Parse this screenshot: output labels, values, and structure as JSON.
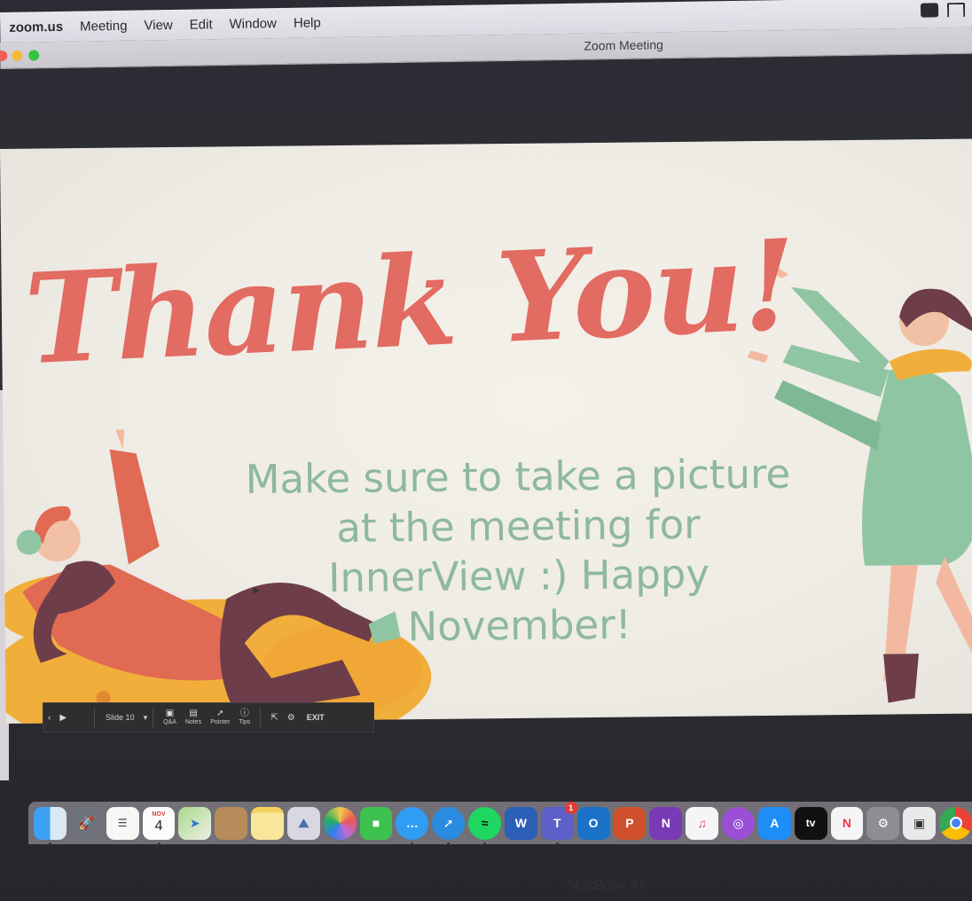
{
  "menubar": {
    "app": "zoom.us",
    "items": [
      "Meeting",
      "View",
      "Edit",
      "Window",
      "Help"
    ],
    "right_icons": [
      "zoom-status-icon",
      "airplay-icon"
    ]
  },
  "window": {
    "title": "Zoom Meeting"
  },
  "slide": {
    "title": "Thank You!",
    "subtitle": "Make sure to take a picture at the meeting for InnerView :) Happy November!",
    "colors": {
      "title": "#e26b62",
      "subtitle": "#8eb8a1",
      "background": "#f1eee7"
    }
  },
  "presenter_toolbar": {
    "slide_label": "Slide 10",
    "buttons": [
      {
        "label": "Q&A",
        "icon": "qa-icon"
      },
      {
        "label": "Notes",
        "icon": "notes-icon"
      },
      {
        "label": "Pointer",
        "icon": "pointer-icon"
      },
      {
        "label": "Tips",
        "icon": "tips-icon"
      }
    ],
    "exit_label": "EXIT"
  },
  "dock": {
    "calendar_month": "NOV",
    "calendar_day": "4",
    "teams_badge": "1",
    "tv_label": "tv",
    "apps": [
      "Finder",
      "Launchpad",
      "Reminders",
      "Calendar",
      "Maps",
      "Contacts",
      "Notes",
      "Preview",
      "Photos",
      "FaceTime",
      "Messages",
      "Safari",
      "Spotify",
      "Word",
      "Teams",
      "Outlook",
      "PowerPoint",
      "OneNote",
      "Music",
      "Podcasts",
      "App Store",
      "TV",
      "News",
      "System Preferences",
      "Screenshot",
      "Chrome"
    ]
  },
  "device_label": "MacBook Air"
}
